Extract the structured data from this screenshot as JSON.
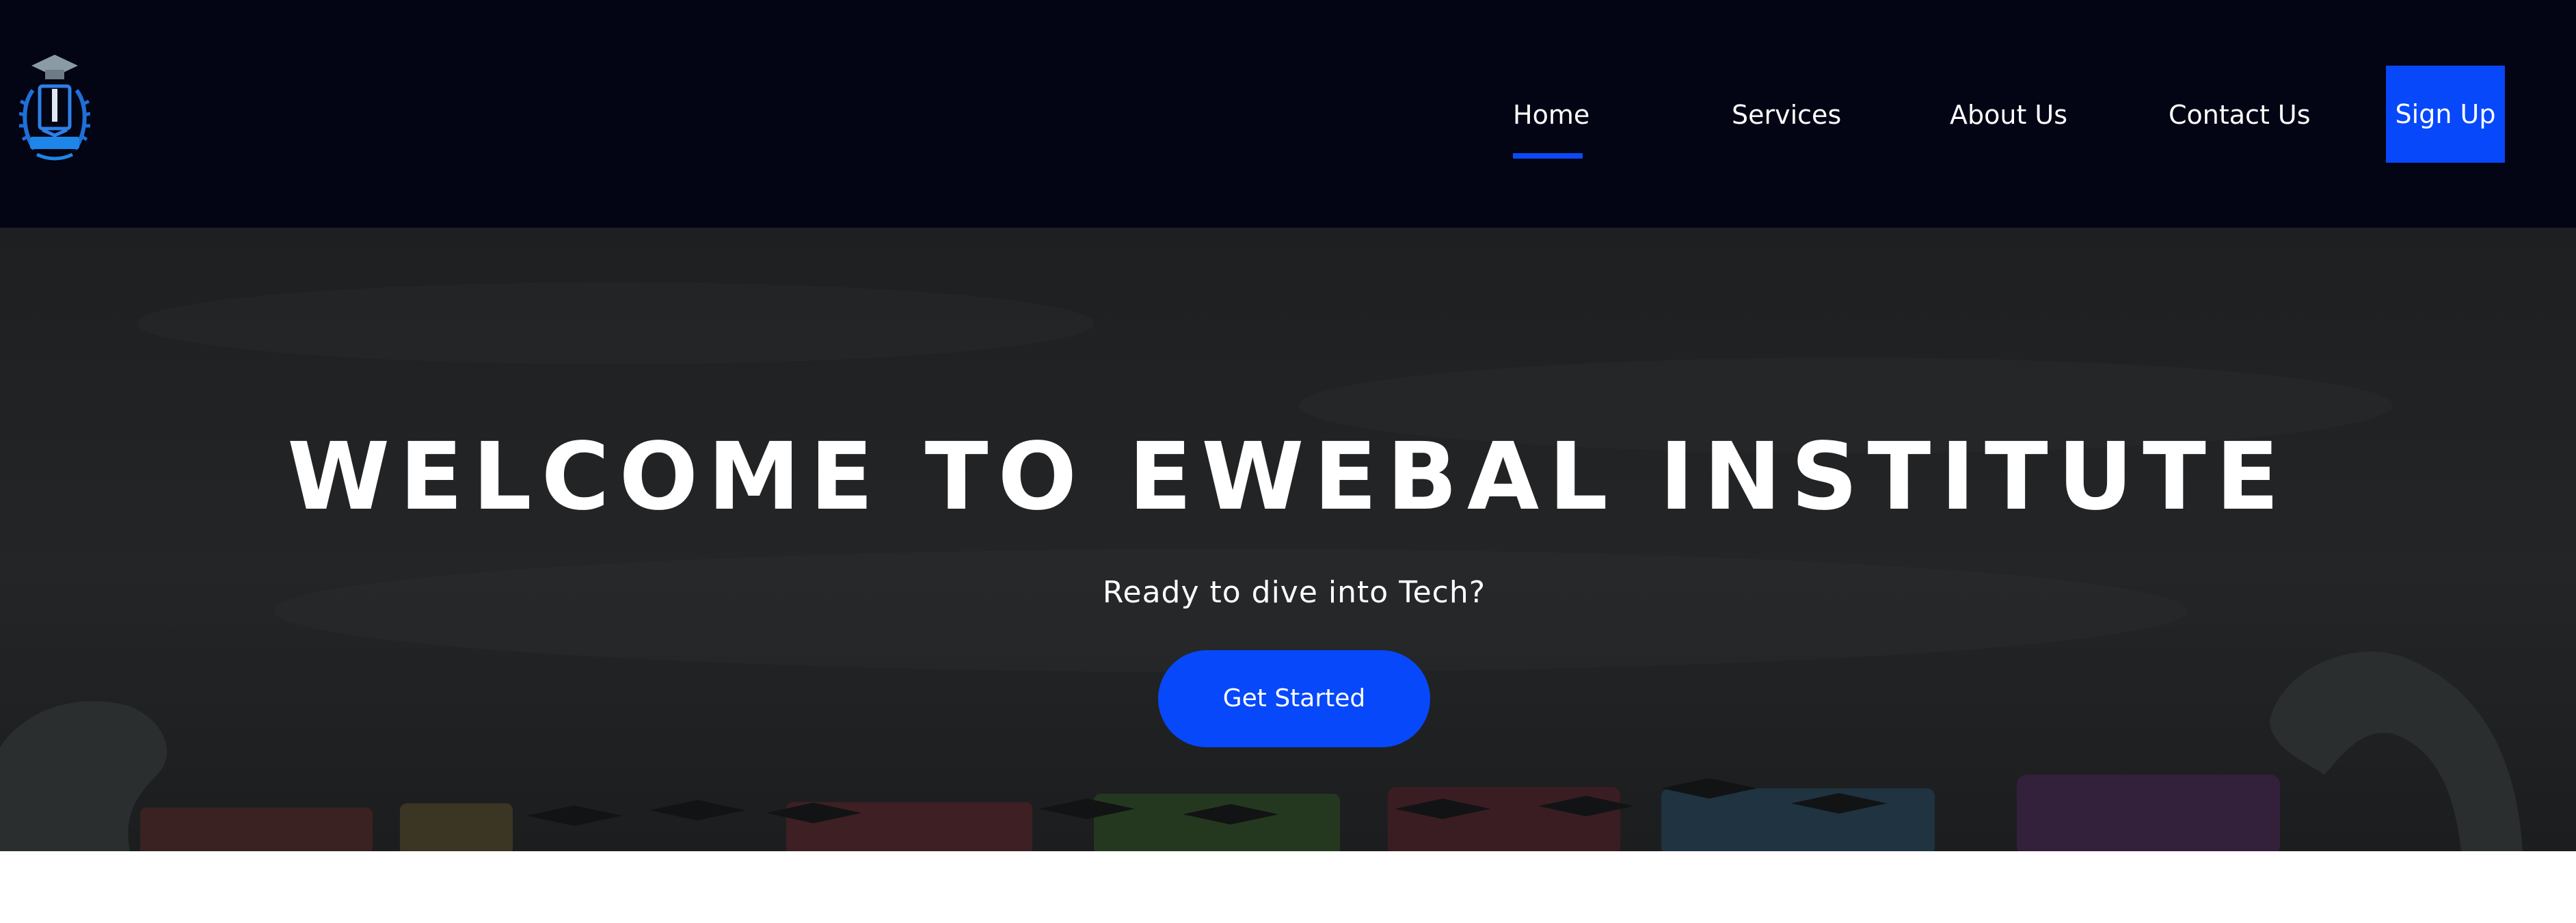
{
  "brand": {
    "logo_icon": "graduation-crest-logo"
  },
  "nav": {
    "items": [
      {
        "label": "Home",
        "active": true
      },
      {
        "label": "Services",
        "active": false
      },
      {
        "label": "About Us",
        "active": false
      },
      {
        "label": "Contact Us",
        "active": false
      }
    ],
    "signup_label": "Sign Up"
  },
  "hero": {
    "title": "WELCOME TO EWEBAL INSTITUTE",
    "subtitle": "Ready to dive into Tech?",
    "cta_label": "Get Started"
  },
  "colors": {
    "navbar_bg": "#030414",
    "accent": "#0748fb",
    "hero_overlay": "#212325",
    "text": "#ffffff"
  }
}
